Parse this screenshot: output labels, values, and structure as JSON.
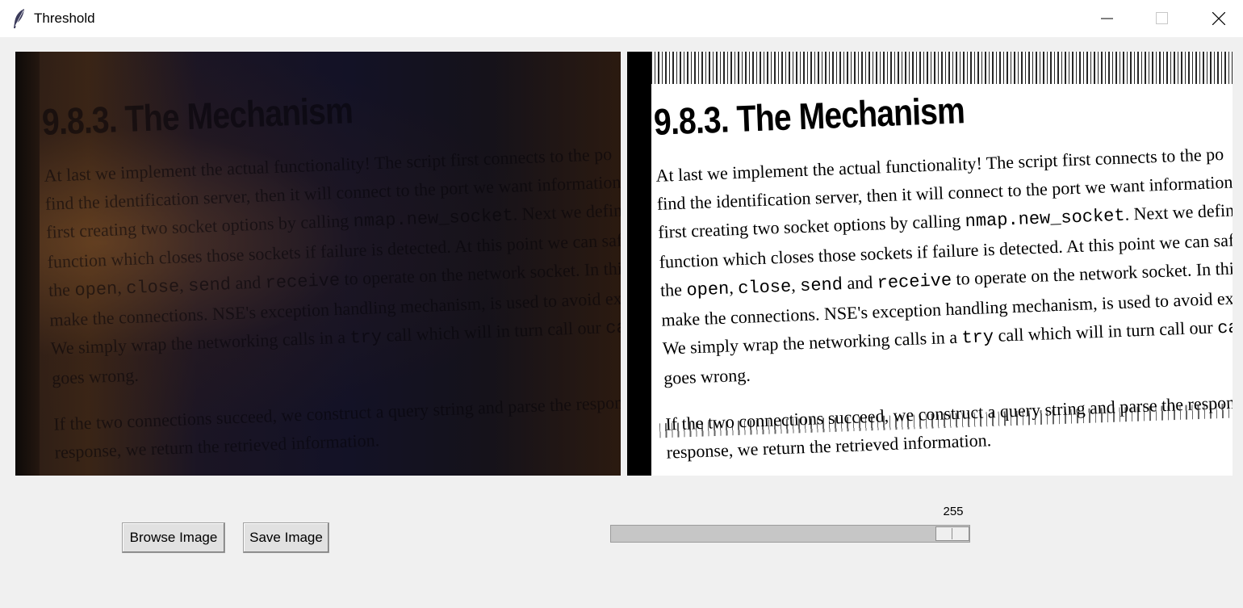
{
  "window": {
    "title": "Threshold",
    "icon": "feather-icon",
    "controls": [
      "minimize-icon",
      "maximize-icon",
      "close-icon"
    ]
  },
  "document": {
    "heading": "9.8.3. The Mechanism",
    "lines": [
      [
        "At last we implement the actual functionality! The script first connects to the po"
      ],
      [
        "find the identification server, then it will connect to the port we want information a"
      ],
      [
        "first creating two socket options by calling ",
        {
          "mono": "nmap.new_socket"
        },
        ". Next we define a"
      ],
      [
        "function which closes those sockets if failure is detected. At this point we can safely"
      ],
      [
        "the ",
        {
          "mono": "open"
        },
        ", ",
        {
          "mono": "close"
        },
        ", ",
        {
          "mono": "send"
        },
        " and ",
        {
          "mono": "receive"
        },
        " to operate on the network socket. In this ca"
      ],
      [
        "make the connections. NSE's exception handling mechanism, is used to avoid excessi"
      ],
      [
        "We simply wrap the networking calls in a ",
        {
          "mono": "try"
        },
        " call which will in turn call our ",
        {
          "mono": "catc"
        }
      ],
      [
        "goes wrong."
      ],
      [
        "If the two connections succeed, we construct a query string and parse the response. If we"
      ],
      [
        "response, we return the retrieved information."
      ]
    ]
  },
  "controls": {
    "browse_label": "Browse Image",
    "save_label": "Save Image"
  },
  "scale": {
    "value": "255",
    "min": 0,
    "max": 255,
    "current": 255
  },
  "colors": {
    "background": "#f0f0f0",
    "titlebar": "#ffffff",
    "trough": "#c6c6c6"
  }
}
